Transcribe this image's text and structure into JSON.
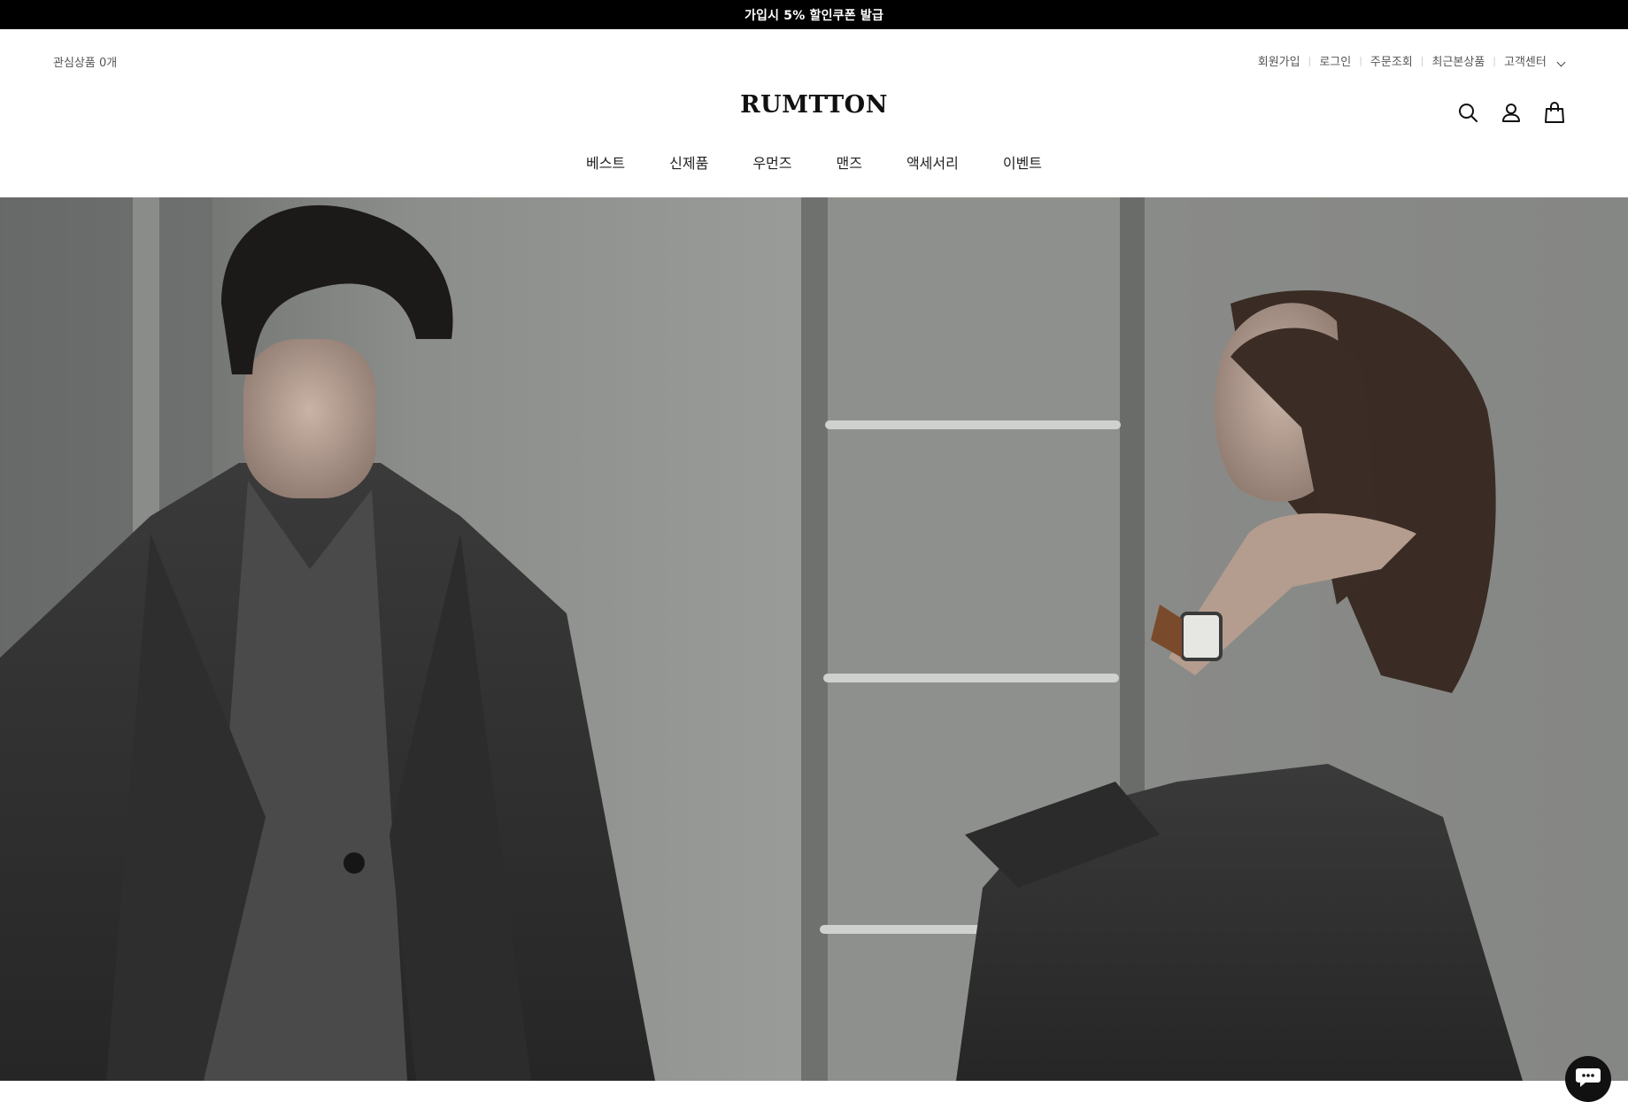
{
  "announcement": {
    "text": "가입시 5% 할인쿠폰 발급"
  },
  "header": {
    "wishlist": "관심상품 0개",
    "util_links": {
      "signup": "회원가입",
      "login": "로그인",
      "order_lookup": "주문조회",
      "recent_viewed": "최근본상품",
      "customer_center": "고객센터"
    },
    "logo": "RUMTTON",
    "icons": [
      "search-icon",
      "user-icon",
      "shopping-bag-icon"
    ]
  },
  "nav": {
    "items": [
      {
        "label": "베스트"
      },
      {
        "label": "신제품"
      },
      {
        "label": "우먼즈"
      },
      {
        "label": "맨즈"
      },
      {
        "label": "액세서리"
      },
      {
        "label": "이벤트"
      }
    ]
  },
  "hero": {
    "image": "two models in dark wool coats against concrete wall with metal ladder"
  },
  "chat": {
    "icon": "chat-bubble-icon"
  },
  "colors": {
    "announcement_bg": "#000000",
    "text_primary": "#222222",
    "text_muted": "#555555"
  }
}
